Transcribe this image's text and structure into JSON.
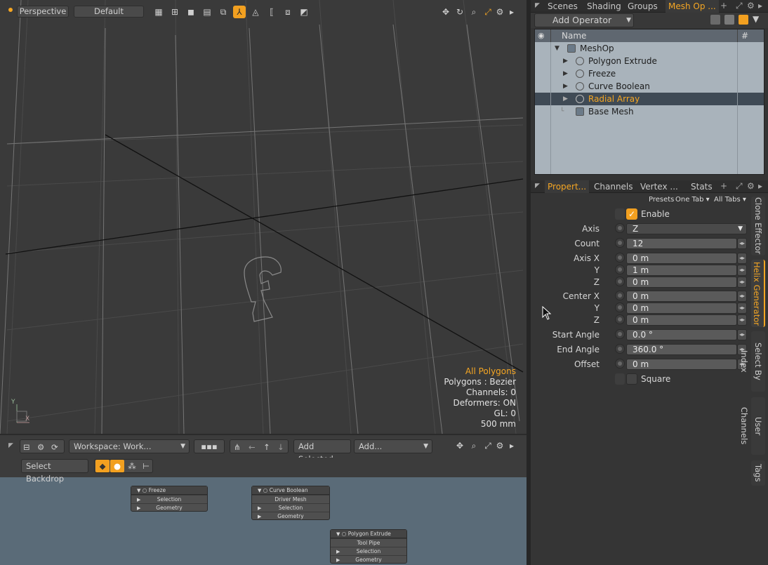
{
  "viewport": {
    "view_mode": "Perspective",
    "shading_preset": "Default",
    "info": {
      "selection": "All Polygons",
      "polygons": "Polygons : Bezier",
      "channels": "Channels: 0",
      "deformers": "Deformers: ON",
      "gl": "GL: 0",
      "scale": "500 mm"
    },
    "axis_labels": {
      "y": "Y",
      "x": "X"
    }
  },
  "mesh_panel": {
    "tabs": [
      "Scenes",
      "Shading",
      "Groups",
      "Mesh Op ..."
    ],
    "active_tab": "Mesh Op ...",
    "add_operator_label": "Add Operator",
    "columns": {
      "name": "Name",
      "hash": "#"
    },
    "tree": [
      {
        "label": "MeshOp",
        "icon": "mesh-icon",
        "level": 0,
        "expanded": true,
        "selected": false
      },
      {
        "label": "Polygon Extrude",
        "icon": "gear-icon",
        "level": 1,
        "expanded": false,
        "selected": false
      },
      {
        "label": "Freeze",
        "icon": "gear-icon",
        "level": 1,
        "expanded": false,
        "selected": false
      },
      {
        "label": "Curve Boolean",
        "icon": "gear-icon",
        "level": 1,
        "expanded": false,
        "selected": false
      },
      {
        "label": "Radial Array",
        "icon": "gear-icon",
        "level": 1,
        "expanded": false,
        "selected": true
      },
      {
        "label": "Base Mesh",
        "icon": "mesh-icon",
        "level": 1,
        "expanded": false,
        "selected": false
      }
    ]
  },
  "properties_panel": {
    "tabs": [
      "Propert...",
      "Channels",
      "Vertex ...",
      "Stats"
    ],
    "active_tab": "Propert...",
    "presets_label": "Presets",
    "one_tab_label": "One Tab",
    "all_tabs_label": "All Tabs",
    "enable_label": "Enable",
    "enable_checked": true,
    "fields": {
      "axis": {
        "label": "Axis",
        "value": "Z"
      },
      "count": {
        "label": "Count",
        "value": "12"
      },
      "axis_x": {
        "label": "Axis X",
        "value": "0 m"
      },
      "axis_y": {
        "label": "Y",
        "value": "1 m"
      },
      "axis_z": {
        "label": "Z",
        "value": "0 m"
      },
      "center_x": {
        "label": "Center X",
        "value": "0 m"
      },
      "center_y": {
        "label": "Y",
        "value": "0 m"
      },
      "center_z": {
        "label": "Z",
        "value": "0 m"
      },
      "start_angle": {
        "label": "Start Angle",
        "value": "0.0 °"
      },
      "end_angle": {
        "label": "End Angle",
        "value": "360.0 °"
      },
      "offset": {
        "label": "Offset",
        "value": "0 m"
      }
    },
    "square_label": "Square",
    "side_tabs": [
      "Clone Effector",
      "Helix Generator",
      "Select By Index",
      "User Channels",
      "Tags"
    ],
    "active_side_tab": "Helix Generator"
  },
  "schematic": {
    "workspace": "Workspace: Work...",
    "add_selected_label": "Add Selected",
    "add_label": "Add...",
    "select_backdrop_label": "Select Backdrop",
    "nodes": [
      {
        "title": "Freeze",
        "rows": [
          "Selection",
          "Geometry"
        ]
      },
      {
        "title": "Curve Boolean",
        "rows": [
          "Driver Mesh",
          "Selection",
          "Geometry"
        ]
      },
      {
        "title": "Polygon Extrude",
        "rows": [
          "Tool Pipe",
          "Selection",
          "Geometry"
        ]
      }
    ]
  },
  "colors": {
    "accent": "#f5a623",
    "selection_bg": "#3f4a55"
  }
}
